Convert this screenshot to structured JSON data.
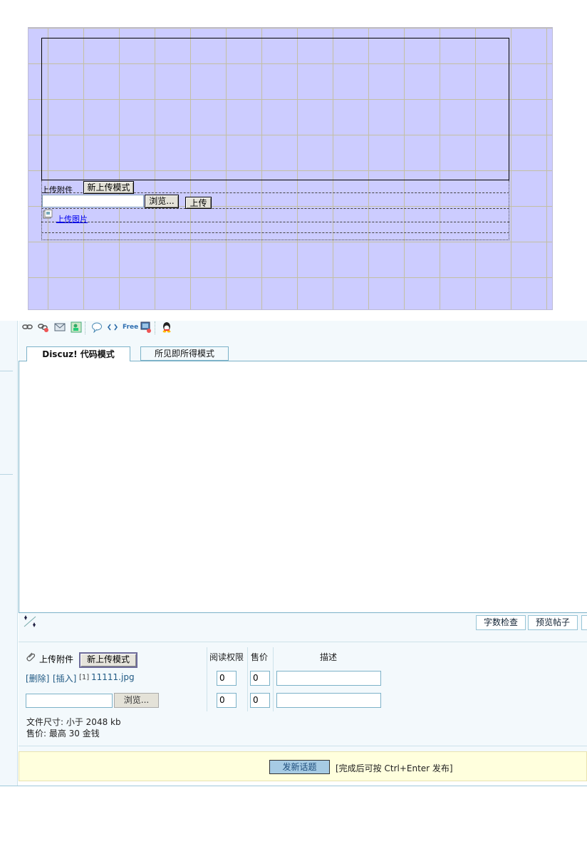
{
  "design_view": {
    "upload_attachment_label": "上传附件",
    "new_upload_mode_button": "新上传模式",
    "browse_button": "浏览...",
    "upload_button": "上传",
    "upload_image_link": "上传图片",
    "grid_color": "#c3bfa3",
    "background_color": "#ccccff"
  },
  "toolbar": {
    "icons": [
      "link-icon",
      "unlink-icon",
      "email-icon",
      "image-icon",
      "quote-icon",
      "code-icon",
      "free-icon",
      "media-icon",
      "qq-icon"
    ],
    "free_label": "Free"
  },
  "tabs": {
    "code_mode": "Discuz! 代码模式",
    "wysiwyg_mode": "所见即所得模式"
  },
  "editor_buttons": {
    "word_count": "字数检查",
    "preview": "预览帖子"
  },
  "attachments": {
    "label": "上传附件",
    "new_upload_mode_button": "新上传模式",
    "headers": {
      "read_permission": "阅读权限",
      "price": "售价",
      "description": "描述"
    },
    "existing": {
      "delete_link": "[删除]",
      "insert_link": "[插入]",
      "index": "[1]",
      "filename": "11111.jpg",
      "read_permission": "0",
      "price": "0",
      "description": ""
    },
    "new_row": {
      "browse_button": "浏览...",
      "read_permission": "0",
      "price": "0",
      "description": ""
    },
    "file_size_note": "文件尺寸: 小于  2048 kb",
    "price_note": "售价: 最高  30 金钱"
  },
  "submit": {
    "button": "发新话题",
    "hint": "[完成后可按  Ctrl+Enter 发布]"
  }
}
